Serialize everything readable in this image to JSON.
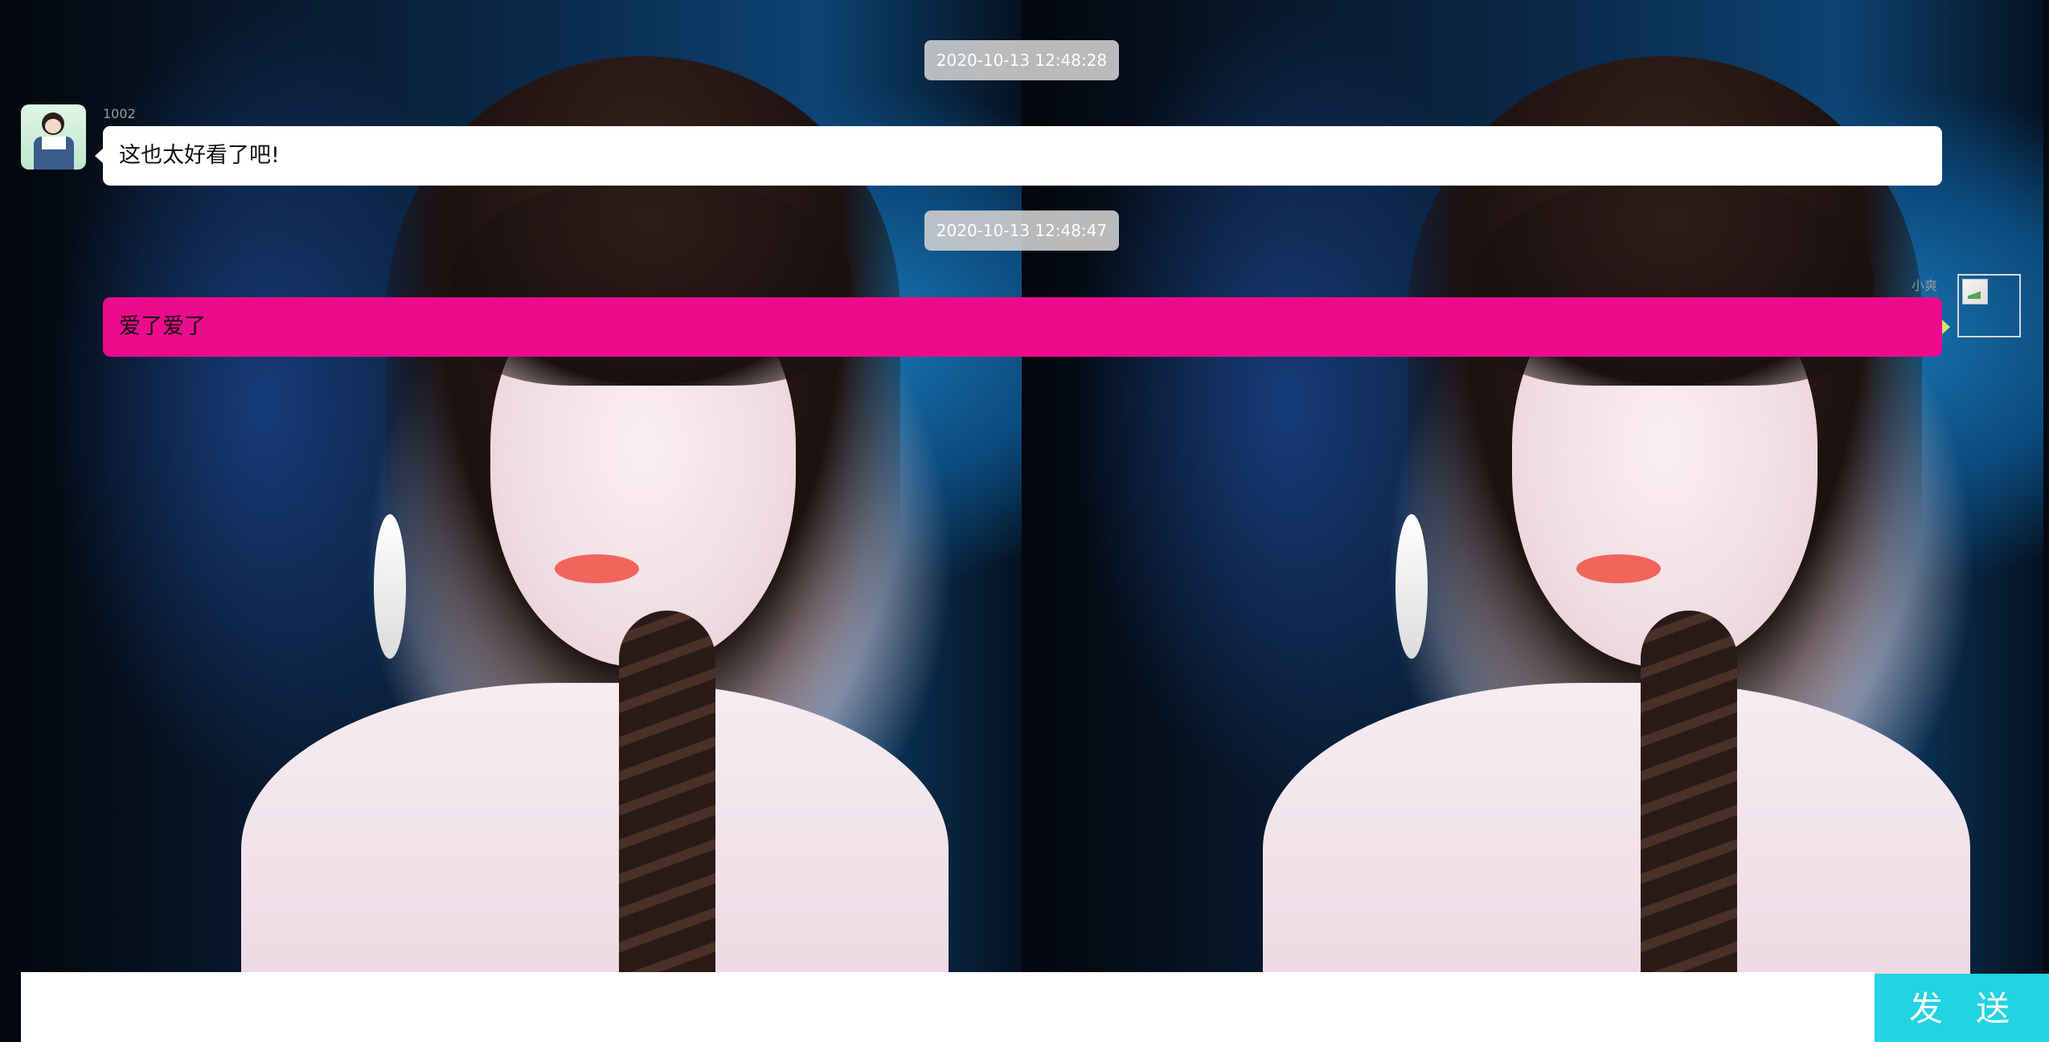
{
  "messages": [
    {
      "timestamp": "2020-10-13 12:48:28",
      "sender": "1002",
      "text": "这也太好看了吧!",
      "side": "left"
    },
    {
      "timestamp": "2020-10-13 12:48:47",
      "sender": "小爽",
      "text": "爱了爱了",
      "side": "right"
    }
  ],
  "composer": {
    "input_value": "",
    "send_label": "发 送"
  },
  "colors": {
    "outgoing_bubble": "#ec0b8c",
    "incoming_bubble": "#ffffff",
    "send_button": "#22d3e0",
    "timestamp_bg": "#cdcdcd"
  }
}
